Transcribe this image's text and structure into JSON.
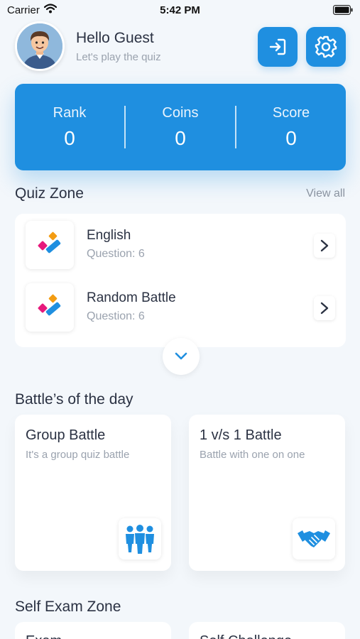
{
  "status_bar": {
    "carrier": "Carrier",
    "time": "5:42 PM"
  },
  "header": {
    "title": "Hello Guest",
    "subtitle": "Let's play the quiz"
  },
  "stats": [
    {
      "label": "Rank",
      "value": "0"
    },
    {
      "label": "Coins",
      "value": "0"
    },
    {
      "label": "Score",
      "value": "0"
    }
  ],
  "quiz_zone": {
    "title": "Quiz Zone",
    "view_all": "View all",
    "items": [
      {
        "name": "English",
        "count": "Question: 6"
      },
      {
        "name": "Random Battle",
        "count": "Question: 6"
      }
    ]
  },
  "battles": {
    "title": "Battle’s of the day",
    "items": [
      {
        "title": "Group Battle",
        "subtitle": "It's a group quiz battle",
        "icon": "group-icon"
      },
      {
        "title": "1 v/s 1 Battle",
        "subtitle": "Battle with one on one",
        "icon": "handshake-icon"
      }
    ]
  },
  "self_exam": {
    "title": "Self Exam Zone",
    "items": [
      {
        "title": "Exam"
      },
      {
        "title": "Self Challenge"
      }
    ]
  },
  "colors": {
    "accent": "#1f8fe0",
    "background": "#f3f7fb",
    "text": "#2b3243",
    "muted": "#9aa2ae"
  }
}
